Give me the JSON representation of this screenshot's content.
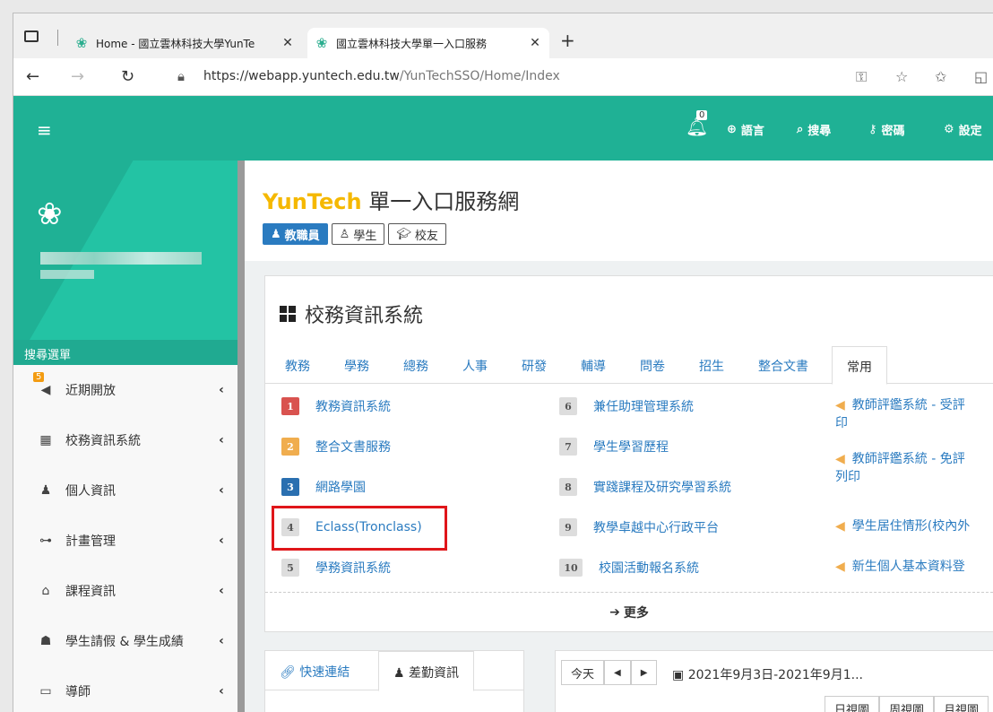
{
  "browser": {
    "tabs": [
      {
        "title": "Home - 國立雲林科技大學YunTe",
        "active": false
      },
      {
        "title": "國立雲林科技大學單一入口服務",
        "active": true
      }
    ],
    "url_host": "https://webapp.yuntech.edu.tw",
    "url_path": "/YunTechSSO/Home/Index"
  },
  "topnav": {
    "notification_count": "0",
    "items": [
      "語言",
      "搜尋",
      "密碼",
      "設定"
    ]
  },
  "sidebar": {
    "menu_title": "搜尋選單",
    "recent_badge": "5",
    "items": [
      {
        "label": "近期開放",
        "icon": "megaphone-icon"
      },
      {
        "label": "校務資訊系統",
        "icon": "windows-icon"
      },
      {
        "label": "個人資訊",
        "icon": "user-icon"
      },
      {
        "label": "計畫管理",
        "icon": "sitemap-icon"
      },
      {
        "label": "課程資訊",
        "icon": "bank-icon"
      },
      {
        "label": "學生請假 & 學生成績",
        "icon": "user-secret-icon"
      },
      {
        "label": "導師",
        "icon": "chalkboard-icon"
      }
    ]
  },
  "header": {
    "brand": "YunTech",
    "title": "單一入口服務網",
    "roles": [
      "教職員",
      "學生",
      "校友"
    ]
  },
  "panel": {
    "title": "校務資訊系統",
    "tabs": [
      "教務",
      "學務",
      "總務",
      "人事",
      "研發",
      "輔導",
      "問卷",
      "招生",
      "整合文書",
      "常用"
    ],
    "active_tab": "常用",
    "col1": [
      {
        "num": "1",
        "label": "教務資訊系統"
      },
      {
        "num": "2",
        "label": "整合文書服務"
      },
      {
        "num": "3",
        "label": "網路學園"
      },
      {
        "num": "4",
        "label": "Eclass(Tronclass)"
      },
      {
        "num": "5",
        "label": "學務資訊系統"
      }
    ],
    "col2": [
      {
        "num": "6",
        "label": "兼任助理管理系統"
      },
      {
        "num": "7",
        "label": "學生學習歷程"
      },
      {
        "num": "8",
        "label": "實踐課程及研究學習系統"
      },
      {
        "num": "9",
        "label": "教學卓越中心行政平台"
      },
      {
        "num": "10",
        "label": "校園活動報名系統"
      }
    ],
    "announcements": [
      {
        "line1": "教師評鑑系統 - 受評",
        "line2": "印"
      },
      {
        "line1": "教師評鑑系統 - 免評",
        "line2": "列印"
      },
      {
        "line1": "學生居住情形(校內外",
        "line2": ""
      },
      {
        "line1": "新生個人基本資料登",
        "line2": ""
      }
    ],
    "more": "更多"
  },
  "quicklinks": {
    "tabs": [
      "快速連結",
      "差勤資訊"
    ]
  },
  "calendar": {
    "today": "今天",
    "prev": "◀",
    "next": "▶",
    "range": "2021年9月3日-2021年9月1...",
    "views": [
      "日視圖",
      "周視圖",
      "月視圖"
    ]
  }
}
